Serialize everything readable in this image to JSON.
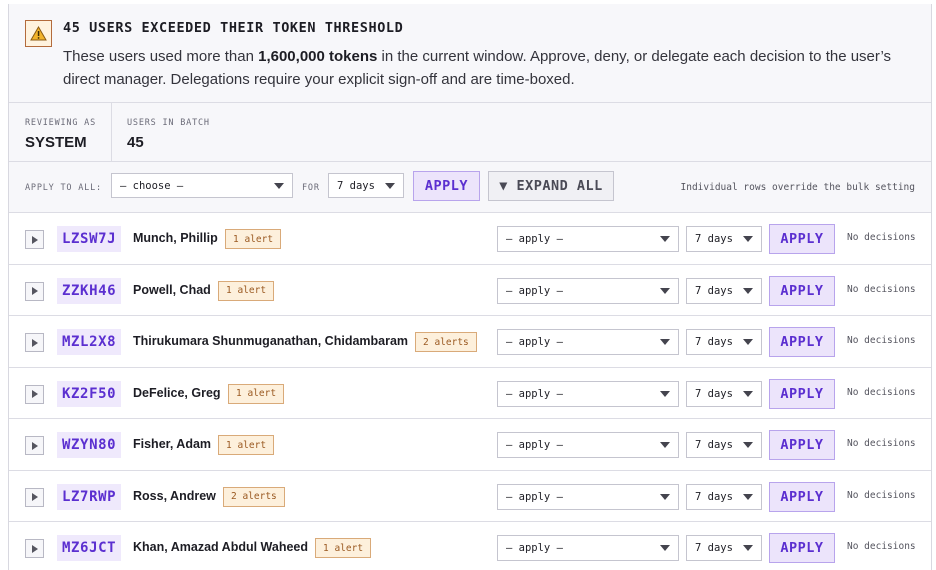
{
  "banner": {
    "icon": "warning-icon",
    "title": "45 USERS EXCEEDED THEIR TOKEN THRESHOLD",
    "desc_before": "These users used more than ",
    "desc_bold": "1,600,000 tokens",
    "desc_after": " in the current window. Approve, deny, or delegate each decision to the user’s direct manager. Delegations require your explicit sign-off and are time-boxed."
  },
  "meta": {
    "reviewing_label": "REVIEWING AS",
    "reviewing_value": "SYSTEM",
    "batch_label": "USERS IN BATCH",
    "batch_value": "45"
  },
  "bulk": {
    "apply_all_label": "APPLY TO ALL:",
    "choose_value": "— choose —",
    "for_label": "FOR",
    "days_value": "7 days",
    "apply_label": "APPLY",
    "expand_label": "▼ EXPAND ALL",
    "note": "Individual rows override the bulk setting"
  },
  "row_controls": {
    "apply_select": "— apply —",
    "days_select": "7 days",
    "apply_button": "APPLY"
  },
  "users": [
    {
      "id": "LZSW7J",
      "name": "Munch, Phillip",
      "alerts": "1 alert",
      "status": "No decisions"
    },
    {
      "id": "ZZKH46",
      "name": "Powell, Chad",
      "alerts": "1 alert",
      "status": "No decisions"
    },
    {
      "id": "MZL2X8",
      "name": "Thirukumara Shunmuganathan, Chidambaram",
      "alerts": "2 alerts",
      "status": "No decisions"
    },
    {
      "id": "KZ2F50",
      "name": "DeFelice, Greg",
      "alerts": "1 alert",
      "status": "No decisions"
    },
    {
      "id": "WZYN80",
      "name": "Fisher, Adam",
      "alerts": "1 alert",
      "status": "No decisions"
    },
    {
      "id": "LZ7RWP",
      "name": "Ross, Andrew",
      "alerts": "2 alerts",
      "status": "No decisions"
    },
    {
      "id": "MZ6JCT",
      "name": "Khan, Amazad Abdul Waheed",
      "alerts": "1 alert",
      "status": "No decisions"
    }
  ],
  "colors": {
    "accent": "#5b2fd0",
    "warning": "#9b5a22"
  }
}
